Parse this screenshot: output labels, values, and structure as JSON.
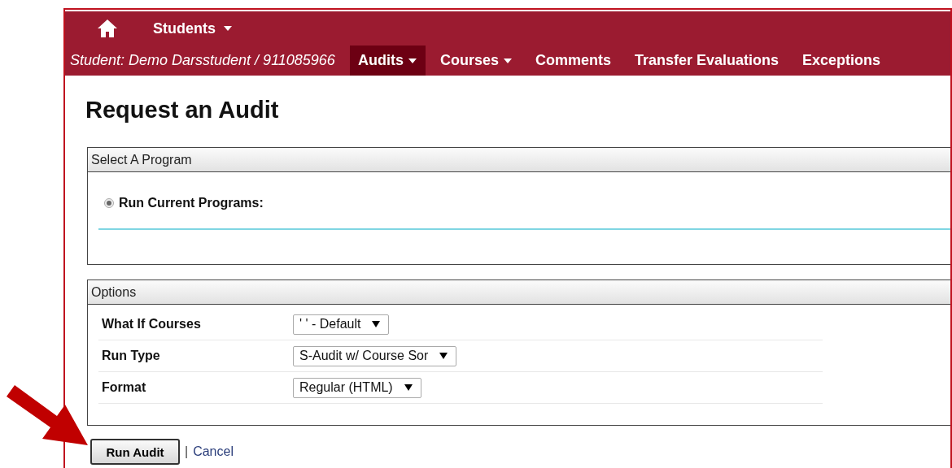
{
  "nav": {
    "menu": {
      "label": "Students",
      "has_menu": true
    },
    "student": "Student: Demo Darsstudent / 911085966",
    "tabs": [
      {
        "label": "Audits",
        "has_menu": true,
        "selected": true
      },
      {
        "label": "Courses",
        "has_menu": true,
        "selected": false
      },
      {
        "label": "Comments",
        "has_menu": false,
        "selected": false
      },
      {
        "label": "Transfer Evaluations",
        "has_menu": false,
        "selected": false
      },
      {
        "label": "Exceptions",
        "has_menu": false,
        "selected": false
      }
    ]
  },
  "page_title": "Request an Audit",
  "program_panel": {
    "title": "Select A Program",
    "radio": {
      "label": "Run Current Programs:",
      "selected": true
    }
  },
  "options_panel": {
    "title": "Options",
    "rows": [
      {
        "label": "What If Courses",
        "value": "' ' - Default"
      },
      {
        "label": "Run Type",
        "value": "S-Audit w/ Course Sor"
      },
      {
        "label": "Format",
        "value": "Regular (HTML)"
      }
    ]
  },
  "actions": {
    "submit": "Run Audit",
    "separator": "|",
    "cancel": "Cancel"
  }
}
